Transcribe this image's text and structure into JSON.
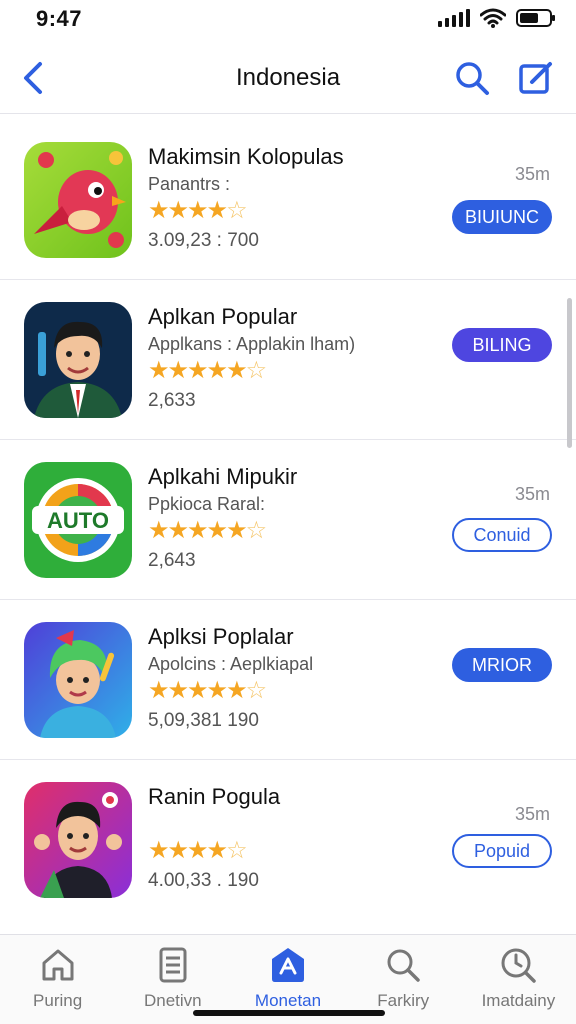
{
  "status_bar": {
    "time": "9:47"
  },
  "nav": {
    "title": "Indonesia"
  },
  "apps": [
    {
      "name": "Makimsin Kolopulas",
      "subtitle": "Panantrs :",
      "stars": "★★★★",
      "meta": "3.09,23 : 700",
      "size": "35m",
      "button": "BIUIUNC"
    },
    {
      "name": "Aplkan Popular",
      "subtitle": "Applkans : Applakin lham)",
      "stars": "★★★★★",
      "meta": "2,633",
      "size": "",
      "button": "BILING"
    },
    {
      "name": "Aplkahi Mipukir",
      "subtitle": "Ppkioca Raral:",
      "stars": "★★★★★",
      "meta": "2,643",
      "size": "35m",
      "button": "Conuid"
    },
    {
      "name": "Aplksi Poplalar",
      "subtitle": "Apolcins : Aeplkiapal",
      "stars": "★★★★★",
      "meta": "5,09,381 190",
      "size": "",
      "button": "MRIOR"
    },
    {
      "name": "Ranin Pogula",
      "subtitle": "",
      "stars": "★★★★",
      "meta": "4.00,33 . 190",
      "size": "35m",
      "button": "Popuid"
    }
  ],
  "tabs": [
    {
      "label": "Puring",
      "icon": "home-icon"
    },
    {
      "label": "Dnetivn",
      "icon": "document-icon"
    },
    {
      "label": "Monetan",
      "icon": "apps-icon"
    },
    {
      "label": "Farkiry",
      "icon": "search-icon"
    },
    {
      "label": "Imatdainy",
      "icon": "clock-search-icon"
    }
  ],
  "colors": {
    "accent": "#2e5fe0",
    "star": "#f5a623",
    "purple_button": "#4e46e0"
  }
}
